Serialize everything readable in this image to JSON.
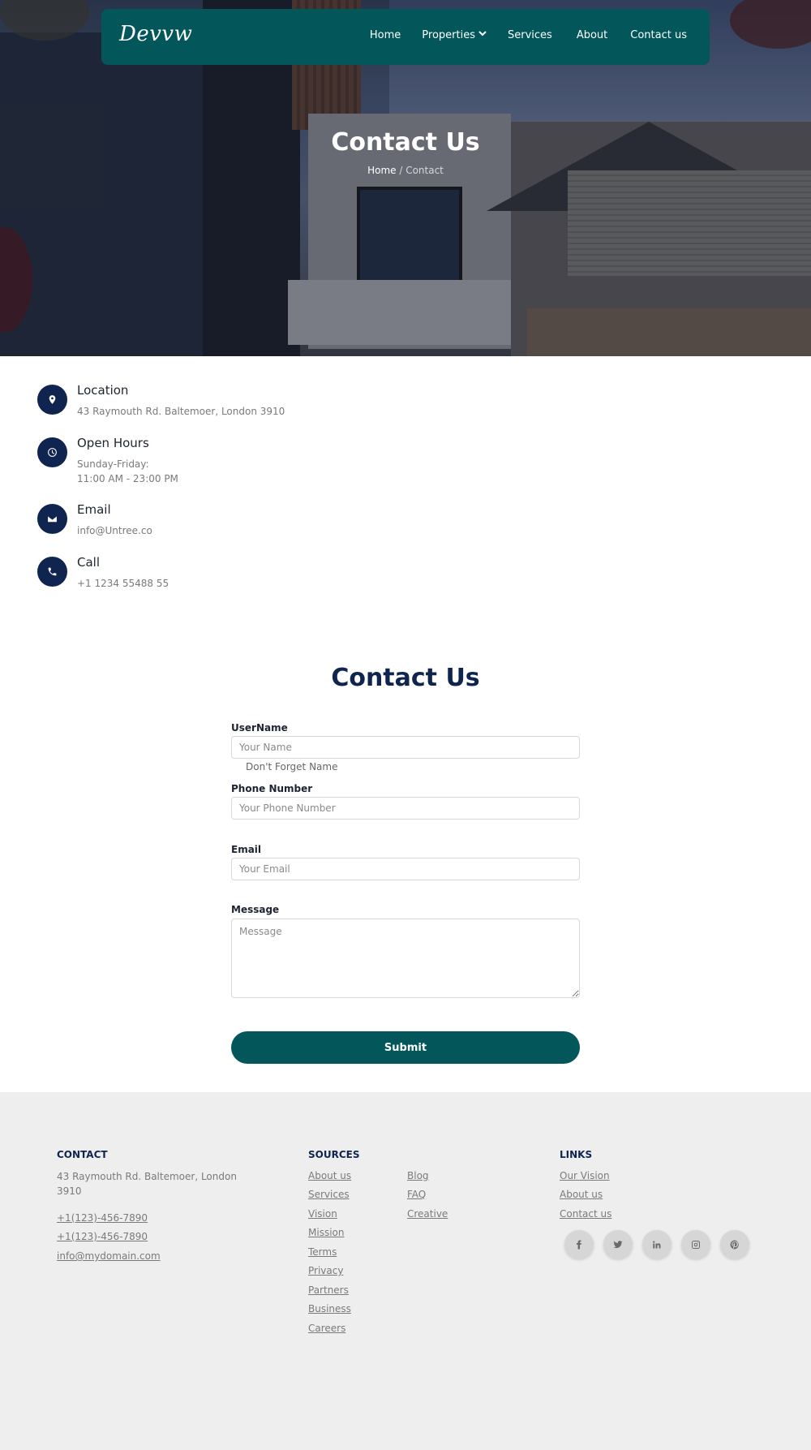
{
  "nav": {
    "logo": "Devvw",
    "items": [
      {
        "label": "Home"
      },
      {
        "label": "Properties"
      },
      {
        "label": "Services"
      },
      {
        "label": "About"
      },
      {
        "label": "Contact us"
      }
    ]
  },
  "hero": {
    "title": "Contact Us",
    "breadcrumb_home": "Home",
    "breadcrumb_sep": " / ",
    "breadcrumb_current": "Contact"
  },
  "contact_info": [
    {
      "icon": "location-pin-icon",
      "title": "Location",
      "lines": [
        "43 Raymouth Rd. Baltemoer, London 3910"
      ]
    },
    {
      "icon": "clock-icon",
      "title": "Open Hours",
      "lines": [
        "Sunday-Friday:",
        "11:00 AM - 23:00 PM"
      ]
    },
    {
      "icon": "envelope-icon",
      "title": "Email",
      "lines": [
        "info@Untree.co"
      ]
    },
    {
      "icon": "phone-icon",
      "title": "Call",
      "lines": [
        "+1 1234 55488 55"
      ]
    }
  ],
  "form": {
    "title": "Contact Us",
    "username_label": "UserName",
    "username_placeholder": "Your Name",
    "username_hint": "Don't Forget Name",
    "phone_label": "Phone Number",
    "phone_placeholder": "Your Phone Number",
    "email_label": "Email",
    "email_placeholder": "Your Email",
    "message_label": "Message",
    "message_placeholder": "Message",
    "submit_label": "Submit"
  },
  "footer": {
    "contact": {
      "heading": "CONTACT",
      "address": "43 Raymouth Rd. Baltemoer, London 3910",
      "phone1": "+1(123)-456-7890",
      "phone2": "+1(123)-456-7890",
      "email": "info@mydomain.com"
    },
    "sources": {
      "heading": "SOURCES",
      "col1": [
        "About us",
        "Services",
        "Vision",
        "Mission",
        "Terms",
        "Privacy",
        "Partners",
        "Business",
        "Careers"
      ],
      "col2": [
        "Blog",
        "FAQ",
        "Creative"
      ]
    },
    "links": {
      "heading": "LINKS",
      "items": [
        "Our Vision",
        "About us",
        "Contact us"
      ]
    },
    "social": [
      "facebook-icon",
      "twitter-icon",
      "linkedin-icon",
      "instagram-icon",
      "pinterest-icon"
    ]
  },
  "colors": {
    "nav_bg": "#03575a",
    "accent_dark": "#0f2550",
    "footer_bg": "#eeeeee"
  }
}
